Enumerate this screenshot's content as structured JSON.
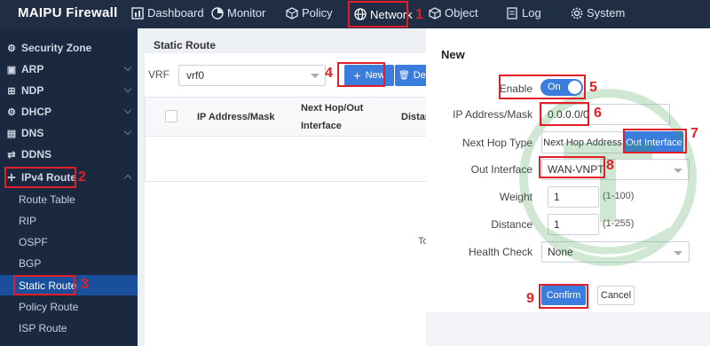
{
  "app": {
    "brand": "MAIPU Firewall"
  },
  "nav": {
    "items": [
      {
        "label": "Dashboard",
        "icon": "dashboard-icon"
      },
      {
        "label": "Monitor",
        "icon": "monitor-icon"
      },
      {
        "label": "Policy",
        "icon": "policy-icon"
      },
      {
        "label": "Network",
        "icon": "globe-icon",
        "active": true
      },
      {
        "label": "Object",
        "icon": "cube-icon"
      },
      {
        "label": "Log",
        "icon": "log-icon"
      },
      {
        "label": "System",
        "icon": "gear-icon"
      }
    ]
  },
  "sidebar": {
    "groups": [
      {
        "label": "Security Zone",
        "icon": "gear-icon"
      },
      {
        "label": "ARP",
        "icon": "arp-icon"
      },
      {
        "label": "NDP",
        "icon": "ndp-icon"
      },
      {
        "label": "DHCP",
        "icon": "dhcp-icon"
      },
      {
        "label": "DNS",
        "icon": "dns-icon"
      },
      {
        "label": "DDNS",
        "icon": "ddns-icon"
      },
      {
        "label": "IPv4 Route",
        "icon": "route-icon",
        "expanded": true
      }
    ],
    "sub_items": [
      "Route Table",
      "RIP",
      "OSPF",
      "BGP",
      "Static Route",
      "Policy Route",
      "ISP Route"
    ],
    "active_sub": "Static Route"
  },
  "main": {
    "title": "Static Route",
    "vrf_label": "VRF",
    "vrf_value": "vrf0",
    "new_label": "New",
    "delete_label": "De",
    "table": {
      "headers": [
        "IP Address/Mask",
        "Next Hop/Out",
        "Interface",
        "Distan"
      ]
    },
    "footer_text": "To"
  },
  "modal": {
    "title": "New",
    "enable_label": "Enable",
    "enable_state": "On",
    "ip_label": "IP Address/Mask",
    "ip_value": "0.0.0.0/0",
    "next_hop_type_label": "Next Hop Type",
    "next_hop_options": [
      "Next Hop Address",
      "Out Interface"
    ],
    "next_hop_selected": "Out Interface",
    "out_interface_label": "Out Interface",
    "out_interface_value": "WAN-VNPT",
    "weight_label": "Weight",
    "weight_value": "1",
    "weight_hint": "(1-100)",
    "distance_label": "Distance",
    "distance_value": "1",
    "distance_hint": "(1-255)",
    "health_check_label": "Health Check",
    "health_check_value": "None",
    "confirm_label": "Confirm",
    "cancel_label": "Cancel"
  },
  "annotations": [
    "1",
    "2",
    "3",
    "4",
    "5",
    "6",
    "7",
    "8",
    "9"
  ],
  "colors": {
    "annotation_red": "#e21f26",
    "primary_blue": "#3b7ddd",
    "nav_bg": "#1f2d45",
    "sidebar_bg": "#1b2940",
    "active_sub_bg": "#1a4f9e"
  }
}
